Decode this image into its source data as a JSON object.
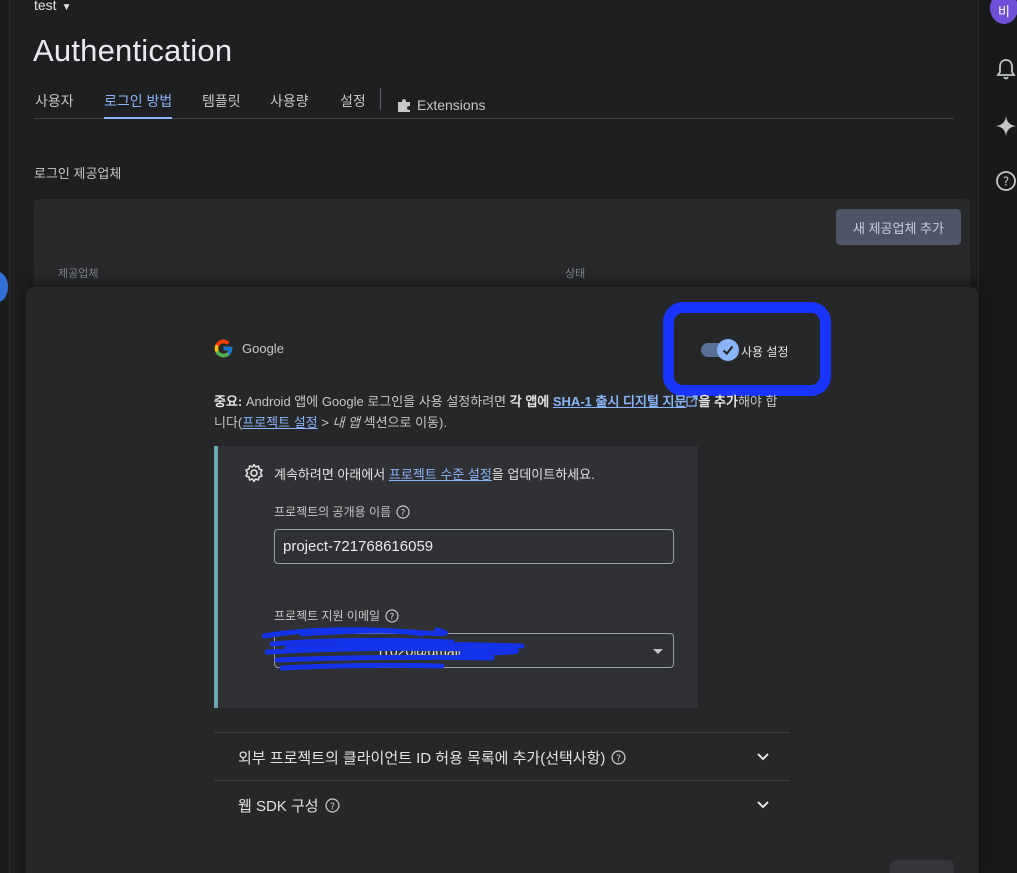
{
  "header": {
    "project_name": "test",
    "page_title": "Authentication"
  },
  "tabs": [
    {
      "label": "사용자",
      "active": false
    },
    {
      "label": "로그인 방법",
      "active": true
    },
    {
      "label": "템플릿",
      "active": false
    },
    {
      "label": "사용량",
      "active": false
    },
    {
      "label": "설정",
      "active": false
    },
    {
      "label": "Extensions",
      "active": false,
      "icon": "extensions-puzzle-icon"
    }
  ],
  "providers_section": {
    "label": "로그인 제공업체",
    "add_button": "새 제공업체 추가",
    "columns": [
      "제공업체",
      "상태"
    ]
  },
  "avatar": {
    "initial": "비"
  },
  "right_rail_icons": [
    "notifications-bell-icon",
    "gemini-sparkle-icon",
    "help-icon"
  ],
  "provider_panel": {
    "provider_name": "Google",
    "enable_toggle": {
      "label": "사용 설정",
      "enabled": true
    },
    "notice": {
      "bold_prefix": "중요:",
      "text_1": " Android 앱에 Google 로그인을 사용 설정하려면 ",
      "bold_mid": "각 앱에",
      "link_sha": "SHA-1 출시 디지털 지문",
      "bold_after": "을 추가",
      "text_2": "해야 합니다(",
      "link_settings": "프로젝트 설정",
      "text_3": " > ",
      "italic": "내 앱",
      "text_4": " 섹션으로 이동)."
    },
    "config": {
      "prefix": "계속하려면 아래에서 ",
      "link": "프로젝트 수준 설정",
      "suffix": "을 업데이트하세요.",
      "public_name_label": "프로젝트의 공개용 이름",
      "public_name_value": "project-721768616059",
      "support_email_label": "프로젝트 지원 이메일",
      "support_email_value": "l1020@gmail.com"
    },
    "expanders": [
      "외부 프로젝트의 클라이언트 ID 허용 목록에 추가(선택사항)",
      "웹 SDK 구성"
    ]
  },
  "colors": {
    "background": "#1e1f20",
    "accent_blue": "#8ab4f8",
    "highlight_annotation": "#1a34ff",
    "config_border": "#6ba6b3"
  }
}
